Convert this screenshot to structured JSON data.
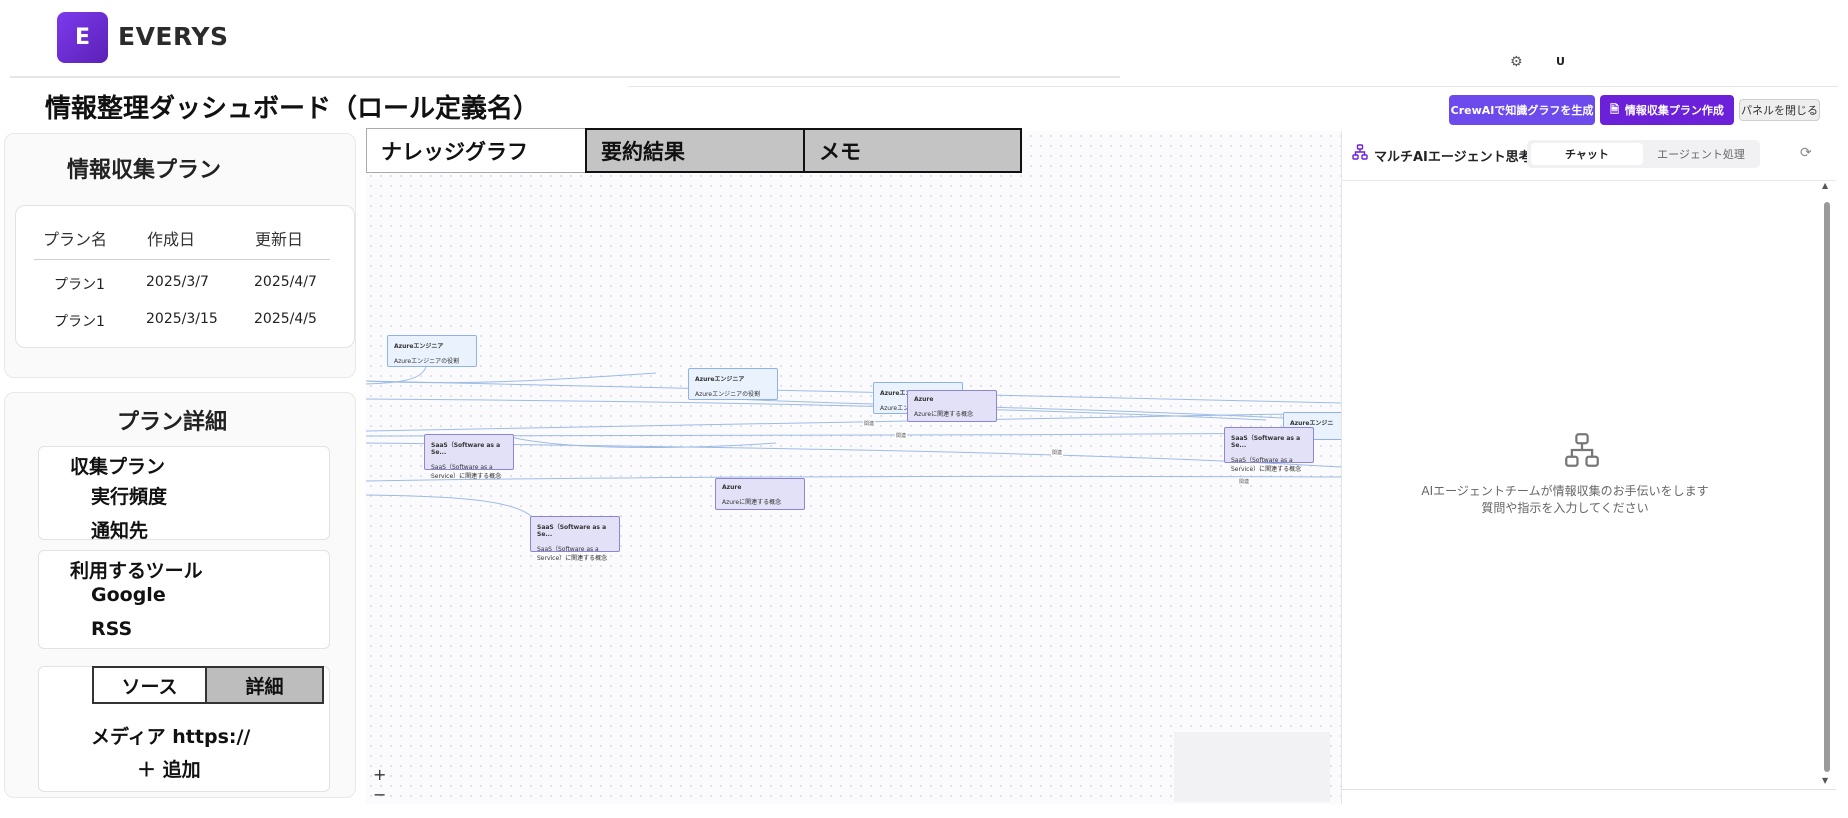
{
  "header": {
    "logo_letter": "E",
    "brand": "EVERYS",
    "user_initial": "U"
  },
  "page": {
    "title": "情報整理ダッシュボード（ロール定義名）",
    "buttons": {
      "crewai": "CrewAIで知識グラフを生成",
      "create_plan": "情報収集プラン作成",
      "close_panel": "パネルを閉じる"
    }
  },
  "left": {
    "plan_heading": "情報収集プラン",
    "table": {
      "headers": [
        "プラン名",
        "作成日",
        "更新日"
      ],
      "rows": [
        [
          "プラン1",
          "2025/3/7",
          "2025/4/7"
        ],
        [
          "プラン1",
          "2025/3/15",
          "2025/4/5"
        ]
      ]
    },
    "detail_heading": "プラン詳細",
    "collect_plan_label": "収集プラン",
    "collect_items": [
      "実行頻度",
      "通知先"
    ],
    "tools_label": "利用するツール",
    "tools": [
      "Google",
      "RSS"
    ],
    "toggle": {
      "source": "ソース",
      "detail": "詳細"
    },
    "media_text": "メディア https://",
    "add_text": "＋ 追加"
  },
  "center": {
    "tabs": [
      "ナレッジグラフ",
      "要約結果",
      "メモ"
    ],
    "active_tab": "ナレッジグラフ",
    "nodes": [
      {
        "title": "Azureエンジニア",
        "desc": "Azureエンジニアの役割",
        "kind": "role"
      },
      {
        "title": "Azureエンジニア",
        "desc": "Azureエンジニアの役割",
        "kind": "role"
      },
      {
        "title": "Azureエンジニア",
        "desc": "Azureエンジニアの役割",
        "kind": "role"
      },
      {
        "title": "Azure",
        "desc": "Azureに関連する概念",
        "kind": "concept"
      },
      {
        "title": "Azureエンジニア",
        "desc": "Azureエンジニアの役割",
        "kind": "role"
      },
      {
        "title": "SaaS（Software as a Se...",
        "desc": "SaaS（Software as a Service）に関連する概念",
        "kind": "concept"
      },
      {
        "title": "Azure",
        "desc": "Azureに関連する概念",
        "kind": "concept"
      },
      {
        "title": "SaaS（Software as a Se...",
        "desc": "SaaS（Software as a Service）に関連する概念",
        "kind": "concept"
      },
      {
        "title": "SaaS（Software as a Se...",
        "desc": "SaaS（Software as a Service）に関連する概念",
        "kind": "concept"
      }
    ],
    "edge_label": "関連",
    "zoom_in": "+",
    "zoom_out": "−"
  },
  "right": {
    "title": "マルチAIエージェント思考",
    "tabs": [
      "チャット",
      "エージェント処理"
    ],
    "active_tab": "チャット",
    "empty_line1": "AIエージェントチームが情報収集のお手伝いをします",
    "empty_line2": "質問や指示を入力してください"
  },
  "colors": {
    "accent": "#6b21d8",
    "crewai_button": "#6d4aec",
    "node_blue": "#e9f2fd",
    "node_purple": "#e3e1f8",
    "edge": "#8fb3e8"
  },
  "icons": [
    "gear-icon",
    "network-icon",
    "refresh-icon",
    "document-icon"
  ]
}
